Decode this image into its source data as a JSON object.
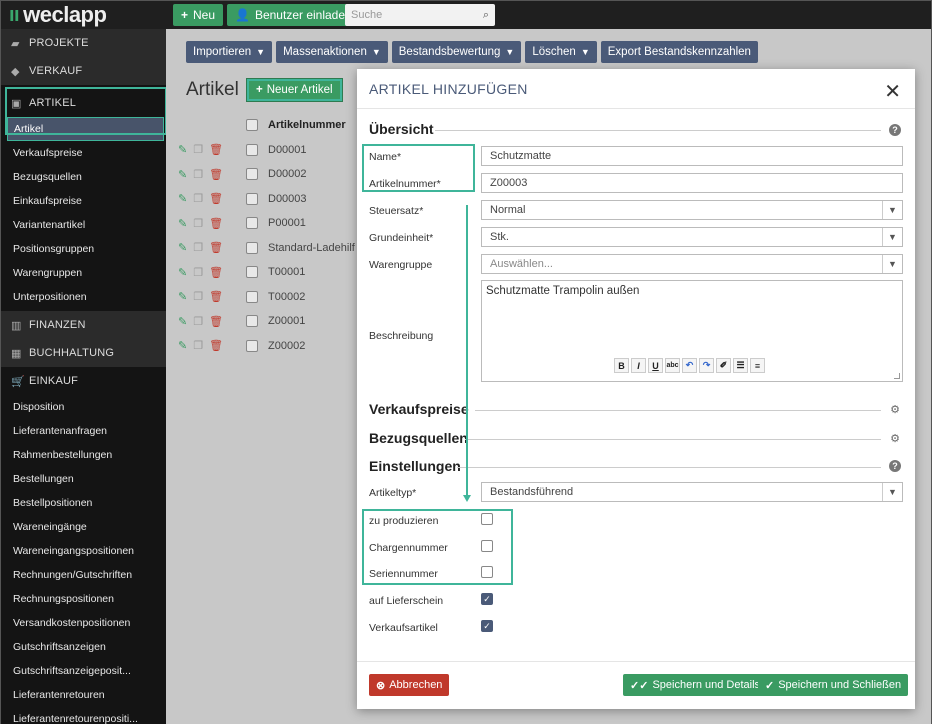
{
  "topbar": {
    "logo_text": "weclapp",
    "new_label": "Neu",
    "invite_label": "Benutzer einladen",
    "search_placeholder": "Suche"
  },
  "sidebar": {
    "sections": [
      {
        "label": "PROJEKTE",
        "icon": "briefcase-icon"
      },
      {
        "label": "VERKAUF",
        "icon": "tag-icon"
      },
      {
        "label": "ARTIKEL",
        "icon": "box-icon"
      },
      {
        "label": "FINANZEN",
        "icon": "bank-icon"
      },
      {
        "label": "BUCHHALTUNG",
        "icon": "calculator-icon"
      },
      {
        "label": "EINKAUF",
        "icon": "cart-icon"
      }
    ],
    "artikel_items": [
      "Artikel",
      "Verkaufspreise",
      "Bezugsquellen",
      "Einkaufspreise",
      "Variantenartikel",
      "Positionsgruppen",
      "Warengruppen",
      "Unterpositionen"
    ],
    "einkauf_items": [
      "Disposition",
      "Lieferantenanfragen",
      "Rahmenbestellungen",
      "Bestellungen",
      "Bestellpositionen",
      "Wareneingänge",
      "Wareneingangspositionen",
      "Rechnungen/Gutschriften",
      "Rechnungspositionen",
      "Versandkostenpositionen",
      "Gutschriftsanzeigen",
      "Gutschriftsanzeigeposit...",
      "Lieferantenretouren",
      "Lieferantenretourenpositi..."
    ]
  },
  "content": {
    "actions": [
      "Importieren",
      "Massenaktionen",
      "Bestandsbewertung",
      "Löschen",
      "Export Bestandskennzahlen"
    ],
    "page_title": "Artikel",
    "new_article_label": "Neuer Artikel",
    "table": {
      "header": "Artikelnummer",
      "rows": [
        "D00001",
        "D00002",
        "D00003",
        "P00001",
        "Standard-Ladehilf",
        "T00001",
        "T00002",
        "Z00001",
        "Z00002"
      ]
    }
  },
  "modal": {
    "title": "ARTIKEL HINZUFÜGEN",
    "sections": {
      "uebersicht": "Übersicht",
      "verkaufspreise": "Verkaufspreise",
      "bezugsquellen": "Bezugsquellen",
      "einstellungen": "Einstellungen"
    },
    "fields": {
      "name_label": "Name*",
      "name_value": "Schutzmatte",
      "artikelnummer_label": "Artikelnummer*",
      "artikelnummer_value": "Z00003",
      "steuersatz_label": "Steuersatz*",
      "steuersatz_value": "Normal",
      "grundeinheit_label": "Grundeinheit*",
      "grundeinheit_value": "Stk.",
      "warengruppe_label": "Warengruppe",
      "warengruppe_placeholder": "Auswählen...",
      "beschreibung_label": "Beschreibung",
      "beschreibung_value": "Schutzmatte Trampolin außen",
      "artikeltyp_label": "Artikeltyp*",
      "artikeltyp_value": "Bestandsführend"
    },
    "checkboxes": [
      {
        "label": "zu produzieren",
        "checked": false
      },
      {
        "label": "Chargennummer",
        "checked": false
      },
      {
        "label": "Seriennummer",
        "checked": false
      },
      {
        "label": "auf Lieferschein",
        "checked": true
      },
      {
        "label": "Verkaufsartikel",
        "checked": true
      }
    ],
    "footer": {
      "cancel_label": "Abbrechen",
      "save_details_label": "Speichern und Details",
      "save_close_label": "Speichern und Schließen"
    }
  },
  "colors": {
    "brand_green": "#3a9b62",
    "highlight": "#3fb59a",
    "navy": "#4a5a78",
    "danger": "#c0392b"
  }
}
